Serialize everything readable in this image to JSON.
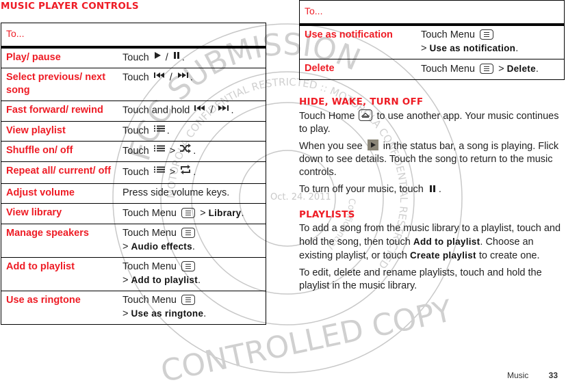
{
  "left": {
    "title": "MUSIC PLAYER CONTROLS",
    "table_header": "To...",
    "rows": [
      {
        "action": "Play/ pause",
        "pre": "Touch",
        "icons": [
          "play-icon",
          "pause-icon"
        ],
        "post": "."
      },
      {
        "action": "Select previous/ next song",
        "pre": "Touch",
        "icons": [
          "previous-icon",
          "next-icon"
        ],
        "post": "."
      },
      {
        "action": "Fast forward/ rewind",
        "pre": "Touch and hold",
        "icons": [
          "previous-icon",
          "next-icon"
        ],
        "post": "."
      },
      {
        "action": "View playlist",
        "pre": "Touch",
        "icons": [
          "playlist-icon"
        ],
        "post": "."
      },
      {
        "action": "Shuffle on/ off",
        "pre": "Touch",
        "icons": [
          "playlist-icon",
          "shuffle-icon"
        ],
        "post": "."
      },
      {
        "action": "Repeat all/ current/ off",
        "pre": "Touch",
        "icons": [
          "playlist-icon",
          "repeat-icon"
        ],
        "post": "."
      },
      {
        "action": "Adjust volume",
        "pre": "Press side volume keys.",
        "icons": [],
        "post": ""
      },
      {
        "action": "View library",
        "pre": "Touch Menu",
        "icons": [
          "menu-key-icon"
        ],
        "target": "Library",
        "post": "."
      },
      {
        "action": "Manage speakers",
        "pre": "Touch Menu",
        "icons": [
          "menu-key-icon"
        ],
        "target": "Audio effects",
        "post": "."
      },
      {
        "action": "Add to playlist",
        "pre": "Touch Menu",
        "icons": [
          "menu-key-icon"
        ],
        "target": "Add to playlist",
        "post": "."
      },
      {
        "action": "Use as ringtone",
        "pre": "Touch Menu",
        "icons": [
          "menu-key-icon"
        ],
        "target": "Use as ringtone",
        "post": "."
      }
    ]
  },
  "right": {
    "table_header": "To...",
    "rows": [
      {
        "action": "Use as notification",
        "pre": "Touch Menu",
        "target": "Use as notification",
        "post": "."
      },
      {
        "action": "Delete",
        "pre": "Touch Menu",
        "target": "Delete",
        "post": "."
      }
    ],
    "hide_title": "HIDE, WAKE, TURN OFF",
    "hide_p1_a": "Touch Home",
    "hide_p1_b": "to use another app. Your music continues to play.",
    "hide_p2_a": "When you see",
    "hide_p2_b": "in the status bar, a song is playing. Flick down to see details. Touch the song to return to the music controls.",
    "hide_p3_a": "To turn off your music, touch",
    "hide_p3_b": ".",
    "playlists_title": "PLAYLISTS",
    "pl_p1_a": "To add a song from the music library to a playlist, touch and hold the song, then touch",
    "pl_p1_b": "Add to playlist",
    "pl_p1_c": ". Choose an existing playlist, or touch",
    "pl_p1_d": "Create playlist",
    "pl_p1_e": "to create one.",
    "pl_p2": "To edit, delete and rename playlists, touch and hold the playlist in the music library."
  },
  "gt": ">",
  "slash": "/",
  "footer": {
    "section": "Music",
    "page": "33"
  },
  "watermark": {
    "outer_top": "FCC SUBMISSION",
    "outer_bottom": "CONTROLLED COPY",
    "ring": "MOTOROLA CONFIDENTIAL RESTRICTED :: MOTOROLA CONFIDENTIAL RESTRICTED ::",
    "inner": "Confidential",
    "date": "Oct. 24. 2011"
  }
}
